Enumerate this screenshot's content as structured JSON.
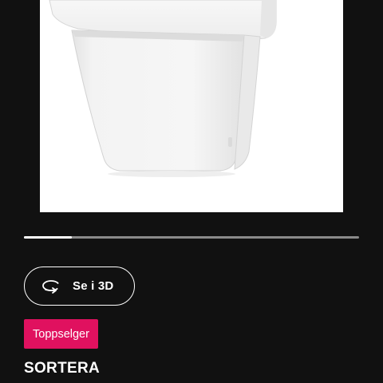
{
  "product": {
    "name": "SORTERA",
    "badge": "Toppselger",
    "image_icon": "white-recycling-bin-image"
  },
  "carousel": {
    "progress": 0.143
  },
  "view_3d": {
    "label": "Se i 3D",
    "icon": "rotate-3d-icon"
  },
  "colors": {
    "background": "#111111",
    "badge": "#e0115f",
    "text": "#ffffff",
    "track": "#8a8a8a"
  }
}
